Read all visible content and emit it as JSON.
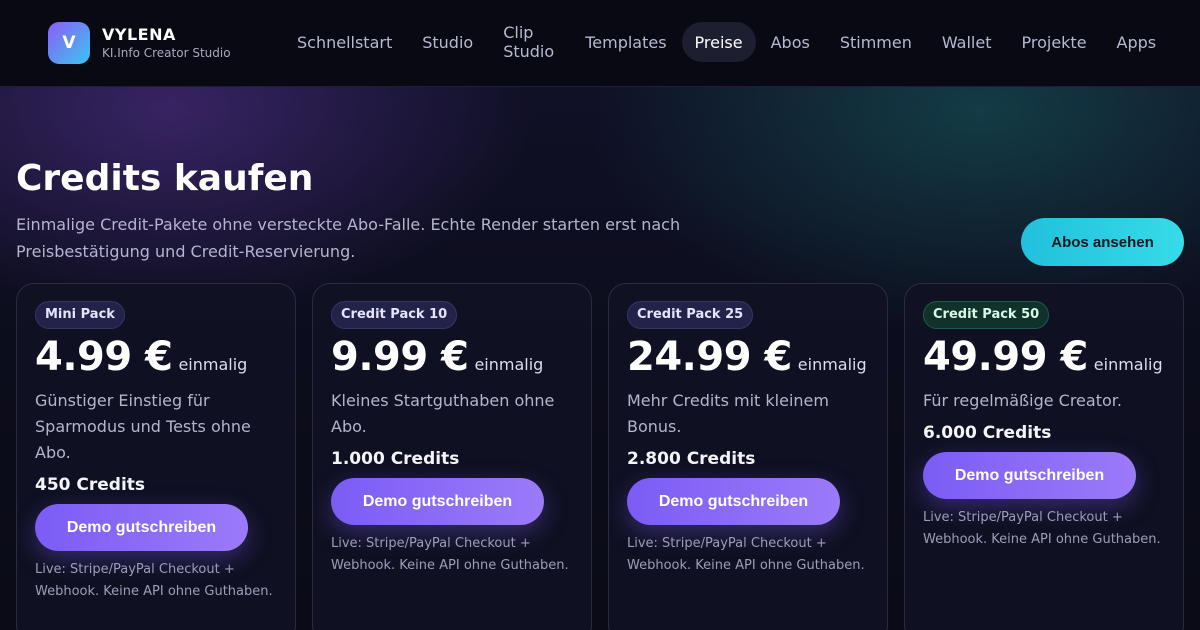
{
  "brand": {
    "initial": "V",
    "name": "VYLENA",
    "subtitle": "KI.Info Creator Studio"
  },
  "nav": {
    "items": [
      {
        "label": "Schnellstart"
      },
      {
        "label": "Studio"
      },
      {
        "label": "Clip Studio"
      },
      {
        "label": "Templates"
      },
      {
        "label": "Preise",
        "active": true
      },
      {
        "label": "Abos"
      },
      {
        "label": "Stimmen"
      },
      {
        "label": "Wallet"
      },
      {
        "label": "Projekte"
      },
      {
        "label": "Apps"
      }
    ]
  },
  "hero": {
    "title": "Credits kaufen",
    "subtitle": "Einmalige Credit-Pakete ohne versteckte Abo-Falle. Echte Render starten erst nach Preisbestätigung und Credit-Reservierung.",
    "cta_label": "Abos ansehen"
  },
  "cards": [
    {
      "badge": "Mini Pack",
      "price": "4.99 €",
      "price_suffix": "einmalig",
      "description": "Günstiger Einstieg für Sparmodus und Tests ohne Abo.",
      "credits": "450 Credits",
      "button_label": "Demo gutschreiben",
      "note": "Live: Stripe/PayPal Checkout + Webhook. Keine API ohne Guthaben."
    },
    {
      "badge": "Credit Pack 10",
      "price": "9.99 €",
      "price_suffix": "einmalig",
      "description": "Kleines Startguthaben ohne Abo.",
      "credits": "1.000 Credits",
      "button_label": "Demo gutschreiben",
      "note": "Live: Stripe/PayPal Checkout + Webhook. Keine API ohne Guthaben."
    },
    {
      "badge": "Credit Pack 25",
      "price": "24.99 €",
      "price_suffix": "einmalig",
      "description": "Mehr Credits mit kleinem Bonus.",
      "credits": "2.800 Credits",
      "button_label": "Demo gutschreiben",
      "note": "Live: Stripe/PayPal Checkout + Webhook. Keine API ohne Guthaben."
    },
    {
      "badge": "Credit Pack 50",
      "price": "49.99 €",
      "price_suffix": "einmalig",
      "description": "Für regelmäßige Creator.",
      "credits": "6.000 Credits",
      "button_label": "Demo gutschreiben",
      "note": "Live: Stripe/PayPal Checkout + Webhook. Keine API ohne Guthaben."
    }
  ],
  "colors": {
    "accent_purple": "#7b5cf5",
    "accent_cyan": "#22c0dd",
    "badge_green": "#11322a"
  }
}
